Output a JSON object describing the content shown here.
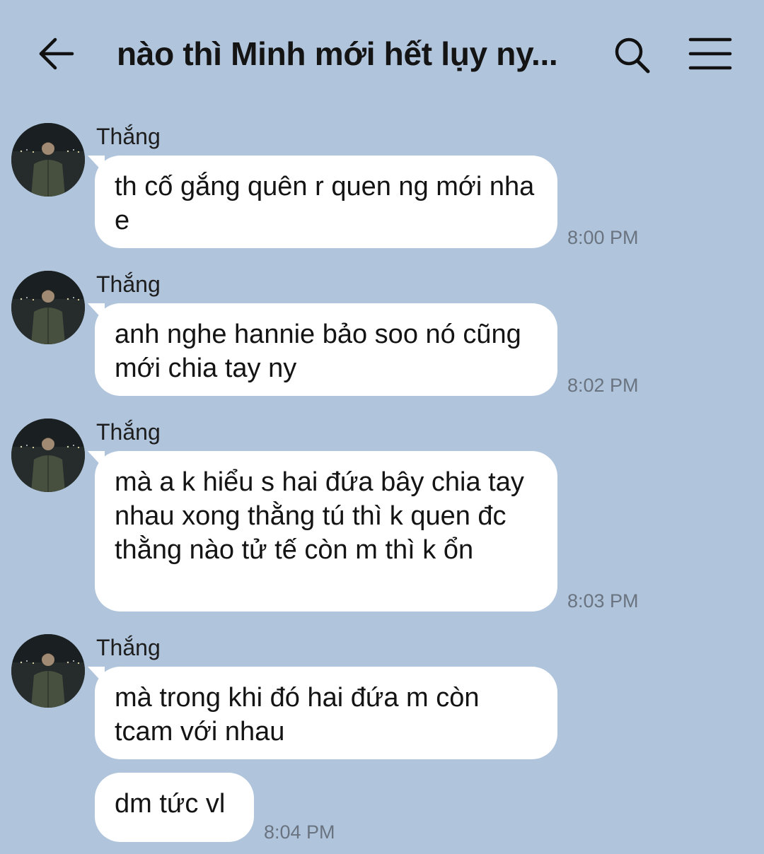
{
  "header": {
    "title": "nào thì Minh mới hết lụy ny..."
  },
  "messages": [
    {
      "sender": "Thắng",
      "text": "th cố gắng quên r quen ng mới nha e",
      "time": "8:00 PM"
    },
    {
      "sender": "Thắng",
      "text": "anh nghe hannie bảo soo nó cũng mới chia tay ny",
      "time": "8:02 PM"
    },
    {
      "sender": "Thắng",
      "text": "mà a k hiểu s hai đứa bây chia tay nhau xong thằng tú thì k quen đc thằng nào tử tế còn m thì k ổn",
      "time": "8:03 PM"
    },
    {
      "sender": "Thắng",
      "text": "mà trong khi đó hai đứa m còn tcam với nhau"
    },
    {
      "text": "dm tức vl",
      "time": "8:04 PM"
    }
  ],
  "colors": {
    "background": "#b0c4dc",
    "bubble": "#ffffff",
    "timestamp": "#6a7480"
  }
}
